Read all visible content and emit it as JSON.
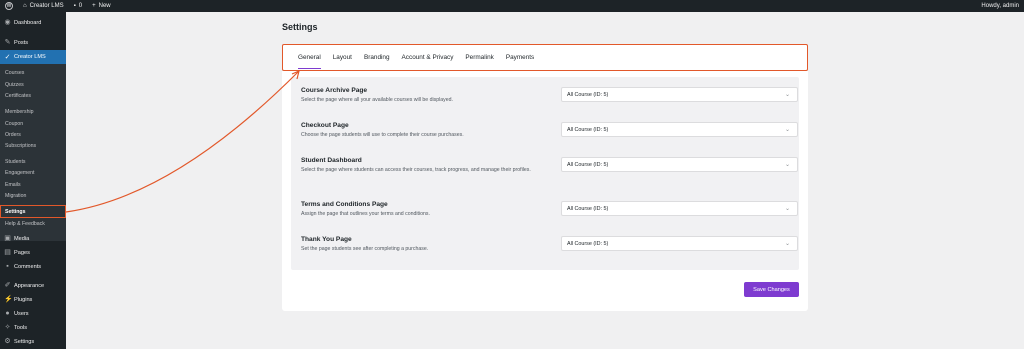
{
  "adminbar": {
    "site_name": "Creator LMS",
    "comments_count": "0",
    "new_label": "New",
    "howdy": "Howdy, admin"
  },
  "sidebar": {
    "dashboard": "Dashboard",
    "posts": "Posts",
    "creator_lms": "Creator LMS",
    "sub": {
      "courses": "Courses",
      "quizzes": "Quizzes",
      "certificates": "Certificates",
      "membership": "Membership",
      "coupon": "Coupon",
      "orders": "Orders",
      "subscriptions": "Subscriptions",
      "students": "Students",
      "engagement": "Engagement",
      "emails": "Emails",
      "migration": "Migration",
      "settings": "Settings",
      "help": "Help & Feedback"
    },
    "media": "Media",
    "pages": "Pages",
    "comments": "Comments",
    "appearance": "Appearance",
    "plugins": "Plugins",
    "users": "Users",
    "tools": "Tools",
    "settings": "Settings"
  },
  "page": {
    "title": "Settings"
  },
  "tabs": [
    "General",
    "Layout",
    "Branding",
    "Account & Privacy",
    "Permalink",
    "Payments"
  ],
  "rows": [
    {
      "label": "Course Archive Page",
      "desc": "Select the page where all your available courses will be displayed.",
      "value": "All Course (ID: 5)"
    },
    {
      "label": "Checkout Page",
      "desc": "Choose the page students will use to complete their course purchases.",
      "value": "All Course (ID: 5)"
    },
    {
      "label": "Student Dashboard",
      "desc": "Select the page where students can access their courses, track progress, and manage their profiles.",
      "value": "All Course (ID: 5)"
    },
    {
      "label": "Terms and Conditions Page",
      "desc": "Assign the page that outlines your terms and conditions.",
      "value": "All Course (ID: 5)"
    },
    {
      "label": "Thank You Page",
      "desc": "Set the page students see after completing a purchase.",
      "value": "All Course (ID: 5)"
    }
  ],
  "save_label": "Save Changes",
  "colors": {
    "accent": "#7e3bd0",
    "highlight": "#e2582a",
    "admin_bg": "#1d2327",
    "active_menu": "#2271b1"
  }
}
